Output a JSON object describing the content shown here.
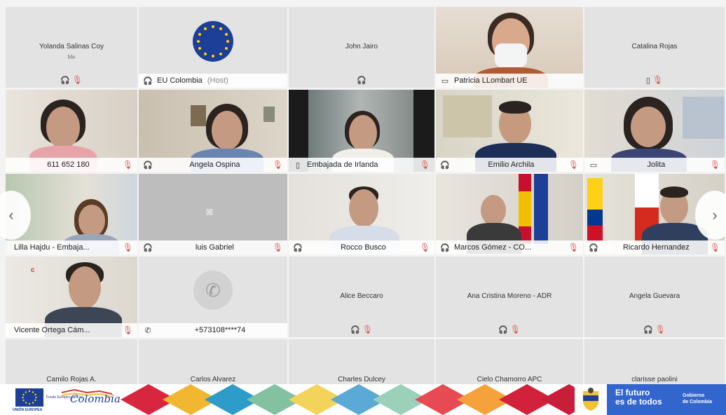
{
  "participants_row1": [
    {
      "name": "Yolanda Salinas Coy",
      "sub": "Me"
    },
    {
      "name": "EU Colombia",
      "host": "(Host)"
    },
    {
      "name": "John Jairo"
    },
    {
      "name": "Patricia LLombart UE"
    },
    {
      "name": "Catalina Rojas"
    }
  ],
  "participants_row2": [
    {
      "name": "611 652 180"
    },
    {
      "name": "Angela Ospina"
    },
    {
      "name": "Embajada de Irlanda"
    },
    {
      "name": "Emilio Archila"
    },
    {
      "name": "Jolita"
    }
  ],
  "participants_row3": [
    {
      "name": "Lilla Hajdu - Embaja..."
    },
    {
      "name": "luis Gabriel"
    },
    {
      "name": "Rocco Busco"
    },
    {
      "name": "Marcos Gómez - CO..."
    },
    {
      "name": "Ricardo Hernandez"
    }
  ],
  "participants_row4": [
    {
      "name": "Vicente Ortega Cám..."
    },
    {
      "name": "+573108****74"
    },
    {
      "name": "Alice Beccaro"
    },
    {
      "name": "Ana Cristina Moreno - ADR"
    },
    {
      "name": "Angela Guevara"
    }
  ],
  "participants_row5": [
    {
      "name": "Camilo Rojas A."
    },
    {
      "name": "Carlos Alvarez"
    },
    {
      "name": "Charles Dulcey"
    },
    {
      "name": "Cielo Chamorro APC"
    },
    {
      "name": "clarisse paolini"
    }
  ],
  "icons": {
    "headset": "🎧",
    "mic_muted": "🎙",
    "phone": "✆",
    "camera_off": "◙",
    "prev": "‹",
    "next": "›"
  },
  "banner": {
    "eu_label": "UNIÓN EUROPEA",
    "fp_label": "Fondo Europeo para la",
    "fp_script": "Colombia",
    "gov_slogan_1": "El futuro",
    "gov_slogan_2": "es de todos",
    "gov_name_1": "Gobierno",
    "gov_name_2": "de Colombia"
  },
  "colors": {
    "active_speaker": "#39a8c8",
    "muted": "#d9534f",
    "eu_blue": "#1d3f97",
    "gov_blue": "#3366cc"
  }
}
